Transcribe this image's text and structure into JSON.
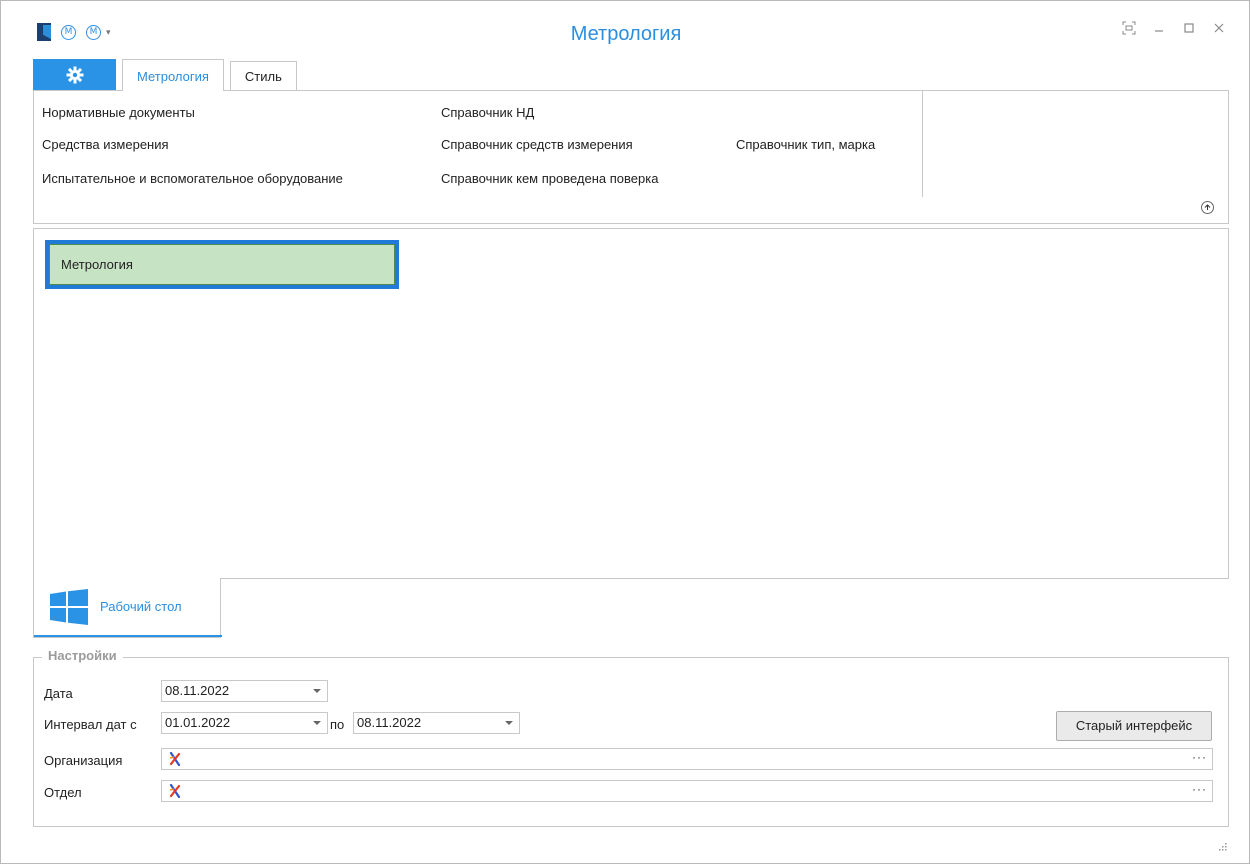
{
  "window": {
    "title": "Метрология",
    "qat_buttons": [
      "M",
      "M"
    ],
    "qat_dropdown": "▾"
  },
  "ribbon": {
    "tabs": [
      {
        "label": "Метрология",
        "active": true
      },
      {
        "label": "Стиль",
        "active": false
      }
    ],
    "items": {
      "norm_docs": "Нормативные документы",
      "measuring_tools": "Средства измерения",
      "test_equipment": "Испытательное и вспомогательное оборудование",
      "ref_nd": "Справочник НД",
      "ref_measuring_tools": "Справочник средств измерения",
      "ref_verified_by": "Справочник кем проведена поверка",
      "ref_type_brand": "Справочник тип, марка"
    }
  },
  "workarea": {
    "tile_label": "Метрология"
  },
  "bottom_tab": {
    "label": "Рабочий стол"
  },
  "settings": {
    "legend": "Настройки",
    "date_label": "Дата",
    "date_value": "08.11.2022",
    "interval_label": "Интервал дат с",
    "interval_from": "01.01.2022",
    "interval_to_label": "по",
    "interval_to": "08.11.2022",
    "org_label": "Организация",
    "dept_label": "Отдел",
    "old_interface_button": "Старый интерфейс",
    "lookup_button": "···"
  },
  "colors": {
    "accent": "#2b93e6",
    "tile_fill": "#c6e3c4",
    "tile_border": "#1f7bd6"
  }
}
